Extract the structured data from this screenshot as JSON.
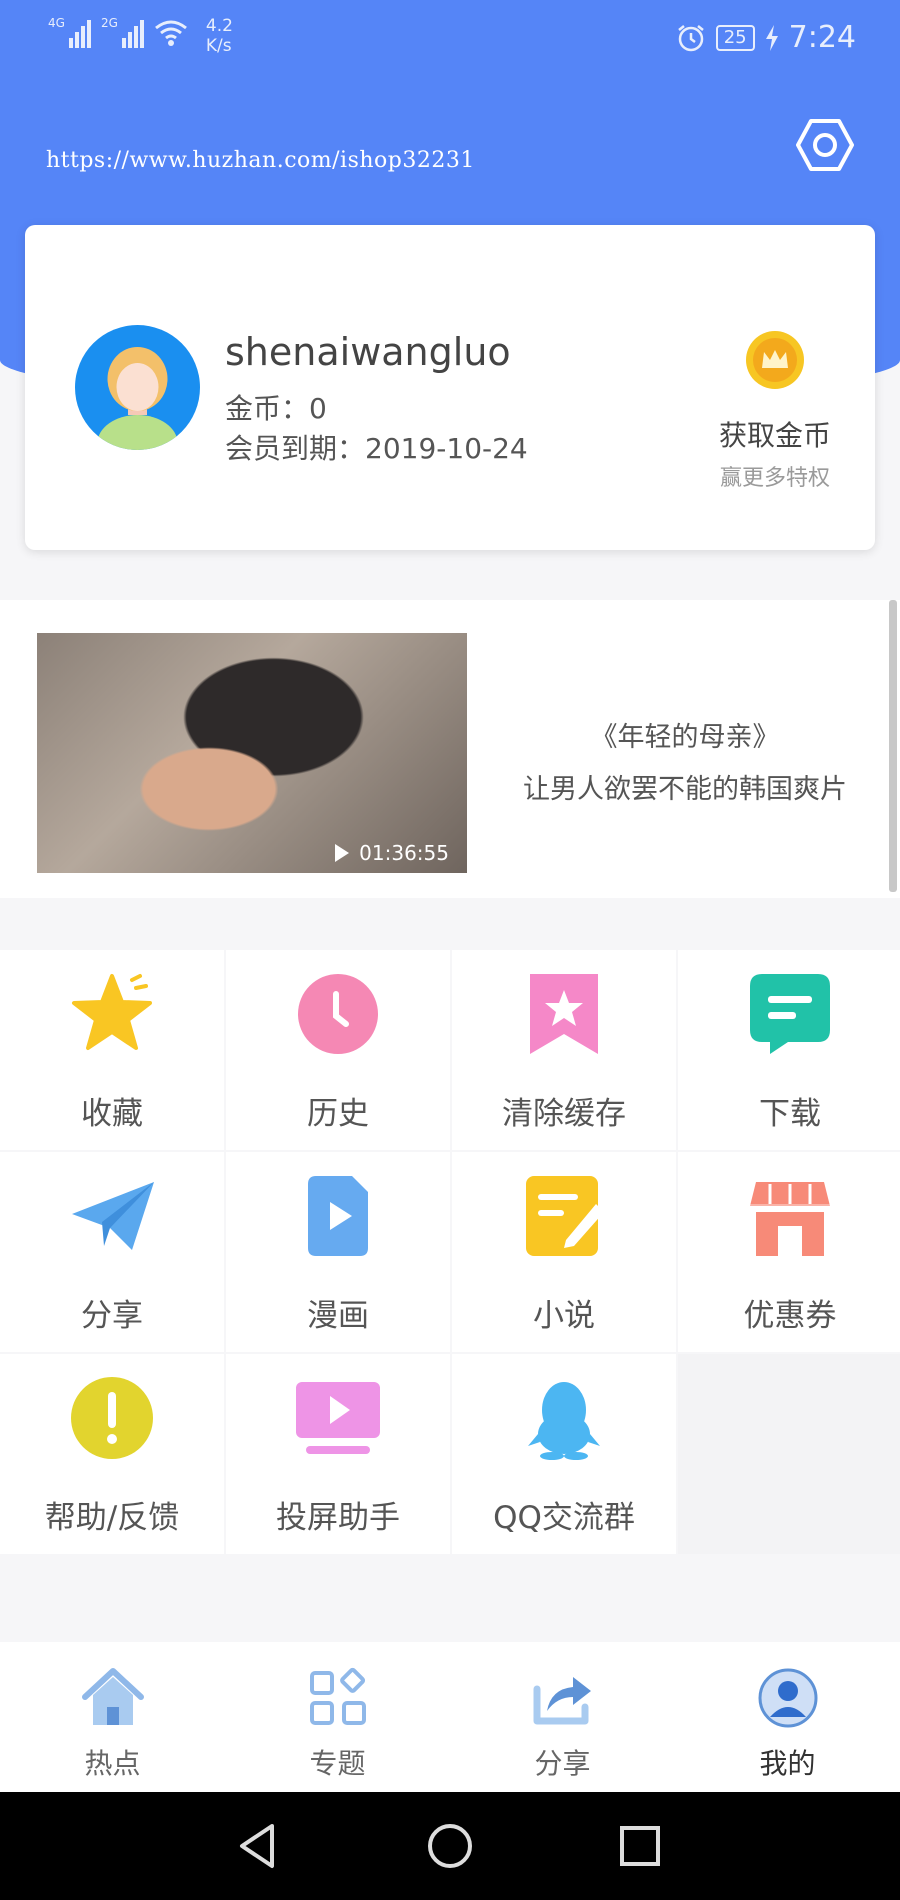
{
  "status_bar": {
    "signal1_label": "4G",
    "signal2_label": "2G",
    "speed_value": "4.2",
    "speed_unit": "K/s",
    "battery": "25",
    "time": "7:24"
  },
  "header": {
    "url_watermark": "https://www.huzhan.com/ishop32231",
    "accent_color": "#5585f7"
  },
  "profile": {
    "username": "shenaiwangluo",
    "coins_label": "金币：",
    "coins_value": "0",
    "expiry_label": "会员到期：",
    "expiry_date": "2019-10-24",
    "get_coins_title": "获取金币",
    "get_coins_subtitle": "赢更多特权"
  },
  "banner": {
    "duration": "01:36:55",
    "title": "《年轻的母亲》",
    "subtitle": "让男人欲罢不能的韩国爽片"
  },
  "menu": {
    "items": [
      {
        "label": "收藏",
        "icon": "star-icon",
        "color": "#f9c623"
      },
      {
        "label": "历史",
        "icon": "clock-icon",
        "color": "#f588b4"
      },
      {
        "label": "清除缓存",
        "icon": "bookmark-star-icon",
        "color": "#f588c8"
      },
      {
        "label": "下载",
        "icon": "message-icon",
        "color": "#21c2a8"
      },
      {
        "label": "分享",
        "icon": "paper-plane-icon",
        "color": "#5aa8ee"
      },
      {
        "label": "漫画",
        "icon": "file-play-icon",
        "color": "#66aaf0"
      },
      {
        "label": "小说",
        "icon": "note-edit-icon",
        "color": "#f9c623"
      },
      {
        "label": "优惠券",
        "icon": "shop-icon",
        "color": "#f78a78"
      },
      {
        "label": "帮助/反馈",
        "icon": "exclamation-icon",
        "color": "#e2d42e"
      },
      {
        "label": "投屏助手",
        "icon": "screen-play-icon",
        "color": "#ee94e6"
      },
      {
        "label": "QQ交流群",
        "icon": "qq-penguin-icon",
        "color": "#4cb6f2"
      }
    ]
  },
  "tabbar": {
    "tabs": [
      {
        "label": "热点",
        "icon": "home-icon"
      },
      {
        "label": "专题",
        "icon": "grid-icon"
      },
      {
        "label": "分享",
        "icon": "share-icon"
      },
      {
        "label": "我的",
        "icon": "user-icon",
        "active": true
      }
    ]
  }
}
